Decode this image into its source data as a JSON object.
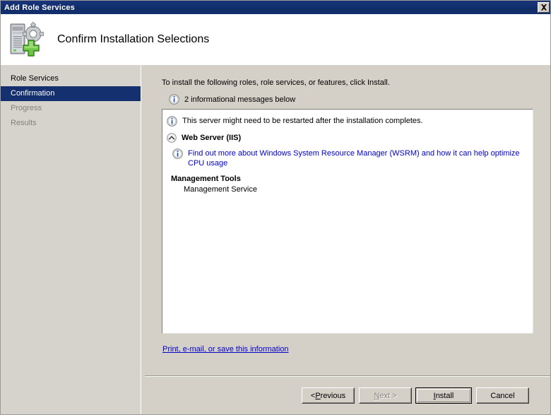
{
  "window": {
    "title": "Add Role Services",
    "close_icon": "close-icon"
  },
  "header": {
    "title": "Confirm Installation Selections",
    "icon": "server-add-icon"
  },
  "sidebar": {
    "items": [
      {
        "label": "Role Services",
        "state": "normal"
      },
      {
        "label": "Confirmation",
        "state": "selected"
      },
      {
        "label": "Progress",
        "state": "disabled"
      },
      {
        "label": "Results",
        "state": "disabled"
      }
    ]
  },
  "main": {
    "intro_text": "To install the following roles, role services, or features, click Install.",
    "info_summary": "2 informational messages below",
    "info_icon": "info-icon",
    "listbox": {
      "restart_notice": "This server might need to be restarted after the installation completes.",
      "section": {
        "title": "Web Server (IIS)",
        "collapse_icon": "chevron-up-circle-icon",
        "wsrm_link": "Find out more about Windows System Resource Manager (WSRM) and how it can help optimize CPU usage",
        "group_title": "Management Tools",
        "group_item": "Management Service"
      }
    },
    "print_link": "Print, e-mail, or save this information"
  },
  "buttons": {
    "previous": {
      "prefix": "< ",
      "accel": "P",
      "rest": "revious"
    },
    "next": {
      "prefix": "",
      "accel": "N",
      "rest": "ext >"
    },
    "install": {
      "prefix": "",
      "accel": "I",
      "rest": "nstall"
    },
    "cancel": {
      "label": "Cancel"
    }
  },
  "colors": {
    "titlebar": "#14306e",
    "selection": "#14306e",
    "dialog_face": "#d4d0c8",
    "link": "#0000cc",
    "disabled_text": "#84817b"
  }
}
